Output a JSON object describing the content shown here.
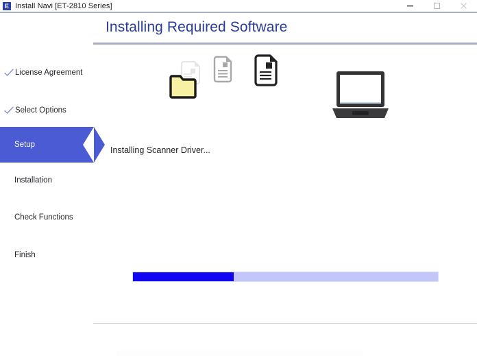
{
  "window": {
    "title": "Install Navi [ET-2810 Series]",
    "app_icon_letter": "E",
    "app_icon_name": "epson-logo-icon",
    "controls": [
      {
        "name": "minimize-button",
        "glyph": "minimize-icon"
      },
      {
        "name": "maximize-button",
        "glyph": "maximize-icon"
      },
      {
        "name": "close-button",
        "glyph": "close-icon"
      }
    ]
  },
  "header": {
    "title": "Installing Required Software",
    "accent_color": "#2a3c96",
    "rule_color": "#a5adc4"
  },
  "sidebar": {
    "active_color": "#4a5bd4",
    "check_color": "#7b8ad6",
    "items": [
      {
        "label": "License Agreement",
        "state": "done"
      },
      {
        "label": "Select Options",
        "state": "done"
      },
      {
        "label": "Setup",
        "state": "active"
      },
      {
        "label": "Installation",
        "state": "pending"
      },
      {
        "label": "Check Functions",
        "state": "pending"
      },
      {
        "label": "Finish",
        "state": "pending"
      }
    ]
  },
  "main": {
    "status_text": "Installing Scanner Driver...",
    "copy_animation": {
      "folder_icon": "folder-icon",
      "folder_color": "#f7f2a3",
      "ghost_document_icon": "document-icon",
      "gray_document_icon": "document-icon",
      "dark_document_icon": "document-icon"
    },
    "device": {
      "icon": "laptop-icon",
      "body_color": "#333336",
      "screen_color": "#ffffff"
    }
  },
  "progress": {
    "percent": 33,
    "fill_color": "#1205f2",
    "track_color": "#c3c6f8"
  }
}
